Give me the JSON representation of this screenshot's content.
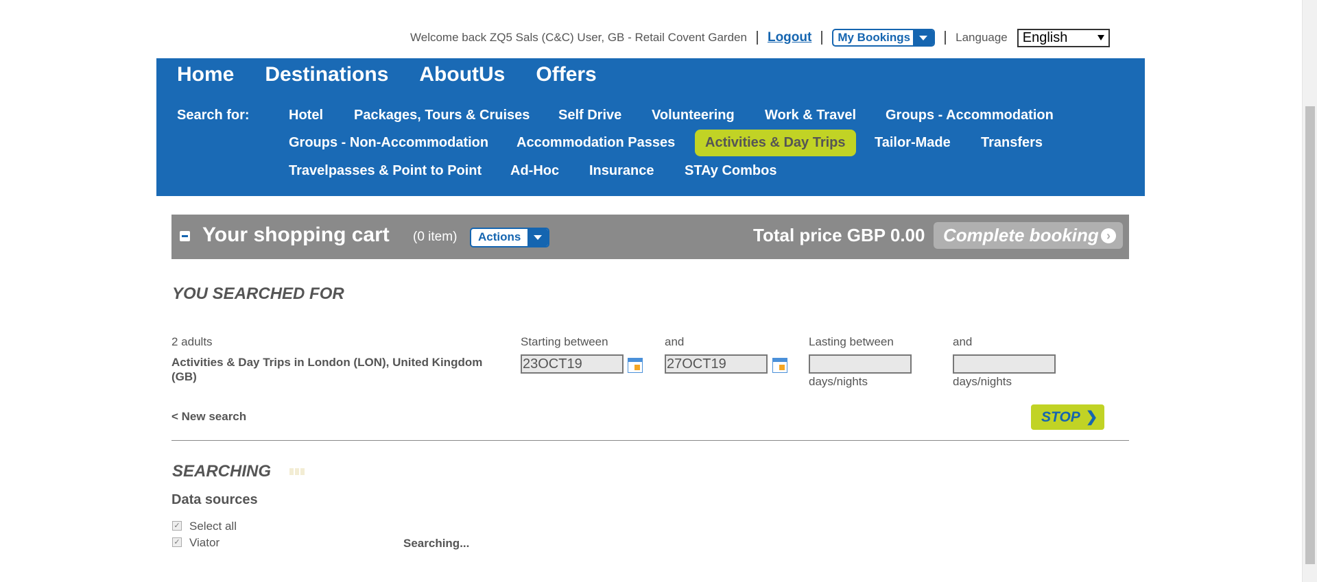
{
  "topbar": {
    "welcome": "Welcome back ZQ5 Sals (C&C) User, GB - Retail Covent Garden",
    "logout": "Logout",
    "my_bookings": "My Bookings",
    "language_label": "Language",
    "language_value": "English"
  },
  "nav": {
    "main": [
      "Home",
      "Destinations",
      "AboutUs",
      "Offers"
    ],
    "search_for": "Search for:",
    "sub": {
      "hotel": "Hotel",
      "packages": "Packages, Tours & Cruises",
      "self_drive": "Self Drive",
      "volunteering": "Volunteering",
      "work_travel": "Work & Travel",
      "groups_accom": "Groups - Accommodation",
      "groups_nonaccom": "Groups - Non-Accommodation",
      "accom_passes": "Accommodation Passes",
      "activities": "Activities & Day Trips",
      "tailor_made": "Tailor-Made",
      "transfers": "Transfers",
      "travelpasses": "Travelpasses & Point to Point",
      "adhoc": "Ad-Hoc",
      "insurance": "Insurance",
      "stay_combos": "STAy Combos"
    },
    "active_color": "#c1d325",
    "bar_color": "#1a6ab5"
  },
  "cart": {
    "title": "Your shopping cart",
    "count": "(0 item)",
    "actions": "Actions",
    "total": "Total price GBP 0.00",
    "complete": "Complete booking"
  },
  "search": {
    "heading": "YOU SEARCHED FOR",
    "adults": "2 adults",
    "description": "Activities & Day Trips in London (LON), United Kingdom (GB)",
    "starting_between": "Starting between",
    "and1": "and",
    "start_date": "23OCT19",
    "end_date": "27OCT19",
    "lasting_between": "Lasting between",
    "and2": "and",
    "days_nights_1": "days/nights",
    "days_nights_2": "days/nights",
    "new_search": "< New search",
    "stop": "STOP"
  },
  "searching": {
    "heading": "SEARCHING",
    "data_sources": "Data sources",
    "select_all": "Select all",
    "source": "Viator",
    "status": "Searching..."
  }
}
